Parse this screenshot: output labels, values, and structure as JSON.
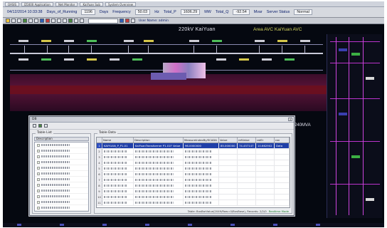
{
  "window": {
    "tabs": [
      "OASIS",
      "D5000 Application",
      "Net Monitor",
      "KaiYuan Sub",
      "System Overview"
    ]
  },
  "status_bar": {
    "date_time": "04/12/2014 10:33:38",
    "days_running_label": "Days_of_Running",
    "days_running_value": "1196",
    "days_unit": "Days",
    "frequency_label": "Frequency",
    "frequency_value": "50.03",
    "frequency_unit": "Hz",
    "total_p_label": "Total_P",
    "total_p_value": "1606.29",
    "total_p_unit": "MW",
    "total_q_label": "Total_Q",
    "total_q_value": "-92.54",
    "total_q_unit": "Mvar",
    "server_status_label": "Server Status",
    "server_status_value": "Normal"
  },
  "toolbar": {
    "icons": [
      "open-icon",
      "save-icon",
      "print-icon",
      "refresh-icon",
      "zoom-in-icon",
      "zoom-out-icon",
      "pan-icon",
      "alarm-icon",
      "trend-icon",
      "report-icon"
    ],
    "user_text": "User Name: admin"
  },
  "diagram": {
    "title": "220kV KaiYuan",
    "avc_label": "Area AVC   KaiYuan AVC",
    "capacity_label": "240MVA"
  },
  "dialog": {
    "title": "DB",
    "close_glyph": "x",
    "table_list": {
      "label": "Table List",
      "column_header": "Description",
      "items": [
        "",
        "",
        "",
        "",
        "",
        "",
        "",
        "",
        "",
        "",
        "",
        ""
      ]
    },
    "table_data": {
      "label": "Table Data",
      "columns": [
        "",
        "Name",
        "Description",
        "MeasureIndexBy/SCADA",
        "Value",
        "refValue",
        "ratEr",
        "ran"
      ],
      "selected_row": {
        "row_number": "1",
        "name": "KAIYUAN_P_P1.01",
        "description": "KaiYuanTransformer P1.01F Value",
        "measure": "96.0000000",
        "value": "85.000000",
        "ref_value": "74.457147",
        "rat": "10.662902",
        "ran": "Data"
      },
      "row_numbers": [
        "2",
        "3",
        "4",
        "5",
        "6",
        "7",
        "8",
        "9",
        "10",
        "11"
      ],
      "footer_text": "Table: BusBarValue(2049/Row=0/BusBase), Records: 2/2/0",
      "footer_accent": "Realtime Mode"
    }
  }
}
